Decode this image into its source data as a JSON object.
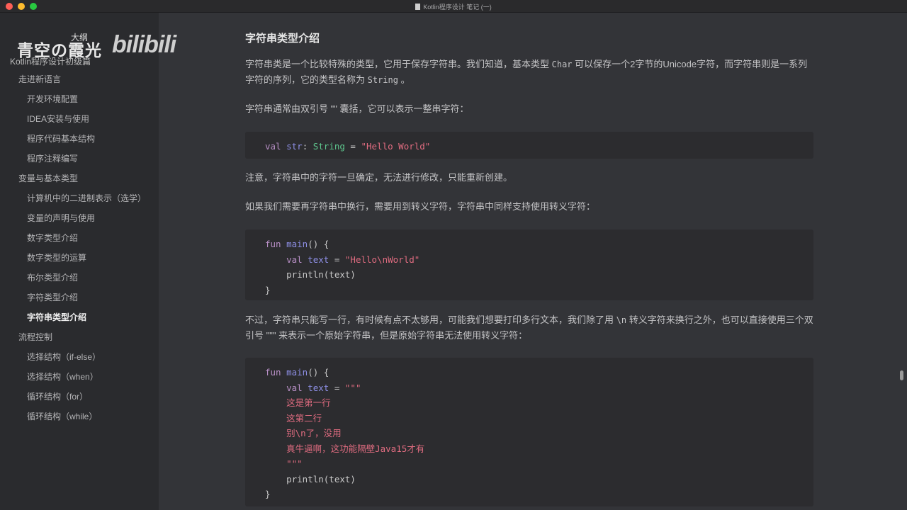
{
  "window": {
    "title": "Kotlin程序设计 笔记 (一)"
  },
  "sidebar": {
    "watermark_top": "大纲",
    "watermark_name": "青空の霞光",
    "watermark_brand": "bilibili",
    "outline_title": "Kotlin程序设计初级篇",
    "items": [
      {
        "label": "走进新语言",
        "level": 1
      },
      {
        "label": "开发环境配置",
        "level": 2
      },
      {
        "label": "IDEA安装与使用",
        "level": 2
      },
      {
        "label": "程序代码基本结构",
        "level": 2
      },
      {
        "label": "程序注释编写",
        "level": 2
      },
      {
        "label": "变量与基本类型",
        "level": 1
      },
      {
        "label": "计算机中的二进制表示（选学）",
        "level": 2
      },
      {
        "label": "变量的声明与使用",
        "level": 2
      },
      {
        "label": "数字类型介绍",
        "level": 2
      },
      {
        "label": "数字类型的运算",
        "level": 2
      },
      {
        "label": "布尔类型介绍",
        "level": 2
      },
      {
        "label": "字符类型介绍",
        "level": 2
      },
      {
        "label": "字符串类型介绍",
        "level": 2,
        "active": true
      },
      {
        "label": "流程控制",
        "level": 1
      },
      {
        "label": "选择结构（if-else）",
        "level": 2
      },
      {
        "label": "选择结构（when）",
        "level": 2
      },
      {
        "label": "循环结构（for）",
        "level": 2
      },
      {
        "label": "循环结构（while）",
        "level": 2
      }
    ]
  },
  "main": {
    "heading": "字符串类型介绍",
    "p1a": "字符串类是一个比较特殊的类型，它用于保存字符串。我们知道，基本类型 ",
    "p1code1": "Char",
    "p1b": " 可以保存一个2字节的Unicode字符，而字符串则是一系列字符的序列，它的类型名称为 ",
    "p1code2": "String",
    "p1c": " 。",
    "p2": "字符串通常由双引号 \"\" 囊括，它可以表示一整串字符：",
    "p3": "注意，字符串中的字符一旦确定，无法进行修改，只能重新创建。",
    "p4": "如果我们需要再字符串中换行，需要用到转义字符，字符串中同样支持使用转义字符：",
    "p5a": "不过，字符串只能写一行，有时候有点不太够用，可能我们想要打印多行文本，我们除了用 ",
    "p5code": "\\n",
    "p5b": " 转义字符来换行之外，也可以直接使用三个双引号 \"\"\" 来表示一个原始字符串，但是原始字符串无法使用转义字符：",
    "code_blocks": [
      [
        [
          [
            "k",
            "val "
          ],
          [
            "v",
            "str"
          ],
          [
            "p",
            ": "
          ],
          [
            "t",
            "String"
          ],
          [
            "p",
            " = "
          ],
          [
            "s",
            "\"Hello World\""
          ]
        ]
      ],
      [
        [
          [
            "k",
            "fun "
          ],
          [
            "f",
            "main"
          ],
          [
            "p",
            "() {"
          ]
        ],
        [
          [
            "p",
            "    "
          ],
          [
            "k",
            "val "
          ],
          [
            "v",
            "text"
          ],
          [
            "p",
            " = "
          ],
          [
            "s",
            "\"Hello\\nWorld\""
          ]
        ],
        [
          [
            "p",
            "    println(text)"
          ]
        ],
        [
          [
            "p",
            "}"
          ]
        ]
      ],
      [
        [
          [
            "k",
            "fun "
          ],
          [
            "f",
            "main"
          ],
          [
            "p",
            "() {"
          ]
        ],
        [
          [
            "p",
            "    "
          ],
          [
            "k",
            "val "
          ],
          [
            "v",
            "text"
          ],
          [
            "p",
            " = "
          ],
          [
            "s",
            "\"\"\""
          ]
        ],
        [
          [
            "s",
            "    这是第一行"
          ]
        ],
        [
          [
            "s",
            "    这第二行"
          ]
        ],
        [
          [
            "s",
            "    别\\n了，没用"
          ]
        ],
        [
          [
            "s",
            "    真牛逼啊，这功能隔壁Java15才有"
          ]
        ],
        [
          [
            "s",
            "    \"\"\""
          ]
        ],
        [
          [
            "p",
            "    println(text)"
          ]
        ],
        [
          [
            "p",
            "}"
          ]
        ]
      ]
    ]
  },
  "colors": {
    "keyword": "#b88fc6",
    "variable": "#8e8fe6",
    "type": "#5dc48c",
    "string": "#e06c80"
  }
}
